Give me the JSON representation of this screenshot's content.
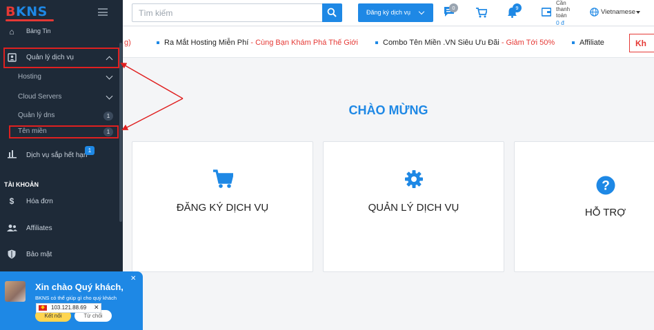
{
  "brand": {
    "logo_b": "B",
    "logo_rest": "KNS"
  },
  "sidebar": {
    "partial_top": "Bảng Tin",
    "services": {
      "label": "Quản lý dịch vụ"
    },
    "sub_items": [
      {
        "label": "Hosting"
      },
      {
        "label": "Cloud Servers"
      },
      {
        "label": "Quản lý dns",
        "badge": "1"
      },
      {
        "label": "Tên miền",
        "badge": "1"
      }
    ],
    "expiring": {
      "label": "Dịch vụ sắp hết hạn",
      "badge": "1"
    },
    "account_heading": "TÀI KHOẢN",
    "account_items": [
      {
        "label": "Hóa đơn",
        "icon": "dollar-icon"
      },
      {
        "label": "Affiliates",
        "icon": "users-icon"
      },
      {
        "label": "Bảo mật",
        "icon": "shield-icon"
      }
    ]
  },
  "header": {
    "search_placeholder": "Tìm kiếm",
    "register_label": "Đăng ký dịch vụ",
    "chat_badge": "0",
    "notif_badge": "9",
    "balance_label": "Cần thanh toán",
    "balance_value": "0 đ",
    "language": "Vietnamese"
  },
  "ticker": {
    "items": [
      {
        "text": "g)"
      },
      {
        "text": "Ra Mắt Hosting Miễn Phí",
        "sep": " - ",
        "highlight": "Cùng Bạn Khám Phá Thế Giới"
      },
      {
        "text": "Combo Tên Miền .VN Siêu Ưu Đãi",
        "sep": " - ",
        "highlight": "Giảm Tới 50%"
      },
      {
        "text": "Affiliate"
      }
    ],
    "boxed": "Kh"
  },
  "main": {
    "welcome": "CHÀO MỪNG",
    "cards": [
      {
        "label": "ĐĂNG KÝ DỊCH VỤ",
        "icon": "cart-icon"
      },
      {
        "label": "QUẢN LÝ DỊCH VỤ",
        "icon": "gear-icon"
      },
      {
        "label": "HỖ TRỢ",
        "icon": "help-icon"
      }
    ]
  },
  "chat": {
    "title": "Xin chào Quý khách,",
    "subtitle": "BKNS có thể giúp gì cho quý khách",
    "connect": "Kết nối",
    "decline": "Từ chối",
    "ip": "103.121.88.69"
  },
  "colors": {
    "accent": "#1e88e5",
    "sidebar": "#1e2a38",
    "highlight_red": "#e53935"
  }
}
